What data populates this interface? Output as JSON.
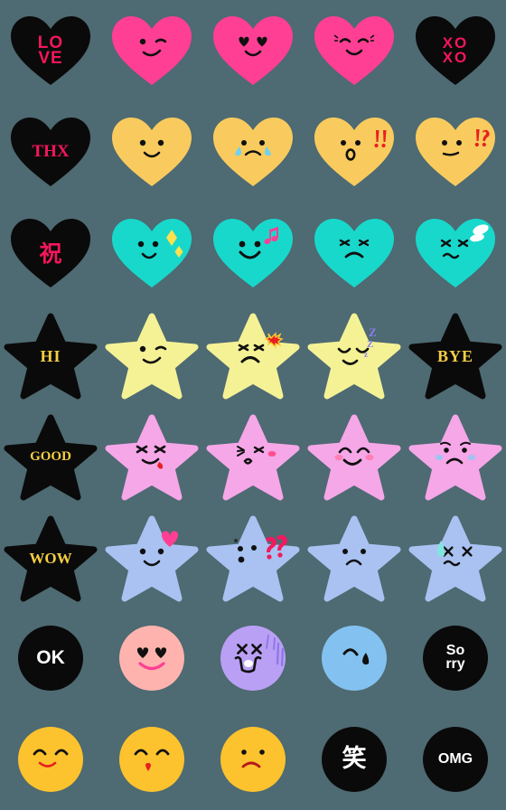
{
  "sheet": {
    "background_color": "#4e6a72",
    "columns": 5,
    "rows": 8,
    "cell_size": 112,
    "palette": {
      "black": "#0a0a0a",
      "hot_pink": "#ff3f93",
      "text_pink": "#f4165c",
      "yellow_heart": "#f9cb5e",
      "teal": "#18d8cc",
      "pale_yellow": "#f5f296",
      "pink_star": "#f5a7e8",
      "blue_star": "#a9c2f2",
      "gold_text": "#f6ce43",
      "white": "#ffffff",
      "peach": "#ffb3ae",
      "purple": "#b9a0f5",
      "sky_blue": "#83c2f0",
      "orange_yellow": "#fcc32e",
      "red": "#e8201f",
      "tear_blue": "#6fd2f0",
      "zzz_purple": "#8a7ef0"
    },
    "stickers": [
      {
        "id": "love-heart",
        "row": 1,
        "col": 1,
        "shape": "heart",
        "fill": "#0a0a0a",
        "text": "LO\nVE",
        "text_style": "lbl-love",
        "face": "none",
        "decor": "none"
      },
      {
        "id": "wink-heart",
        "row": 1,
        "col": 2,
        "shape": "heart",
        "fill": "#ff3f93",
        "text": "",
        "text_style": "",
        "face": "wink",
        "decor": "none"
      },
      {
        "id": "heart-eyes-heart",
        "row": 1,
        "col": 3,
        "shape": "heart",
        "fill": "#ff3f93",
        "text": "",
        "text_style": "",
        "face": "heart-eyes",
        "decor": "none"
      },
      {
        "id": "blush-smile-heart",
        "row": 1,
        "col": 4,
        "shape": "heart",
        "fill": "#ff3f93",
        "text": "",
        "text_style": "",
        "face": "closed-smile",
        "decor": "none"
      },
      {
        "id": "xoxo-heart",
        "row": 1,
        "col": 5,
        "shape": "heart",
        "fill": "#0a0a0a",
        "text": "XO\nXO",
        "text_style": "lbl-xoxo",
        "face": "none",
        "decor": "none"
      },
      {
        "id": "thx-heart",
        "row": 2,
        "col": 1,
        "shape": "heart",
        "fill": "#0a0a0a",
        "text": "THX",
        "text_style": "lbl-thx",
        "face": "none",
        "decor": "none"
      },
      {
        "id": "smile-yellow-heart",
        "row": 2,
        "col": 2,
        "shape": "heart",
        "fill": "#f9cb5e",
        "text": "",
        "text_style": "",
        "face": "smile",
        "decor": "none"
      },
      {
        "id": "crying-yellow-heart",
        "row": 2,
        "col": 3,
        "shape": "heart",
        "fill": "#f9cb5e",
        "text": "",
        "text_style": "",
        "face": "crying",
        "decor": "tears"
      },
      {
        "id": "shocked-yellow-heart",
        "row": 2,
        "col": 4,
        "shape": "heart",
        "fill": "#f9cb5e",
        "text": "",
        "text_style": "",
        "face": "oh-mouth",
        "decor": "double-bang"
      },
      {
        "id": "confused-yellow-heart",
        "row": 2,
        "col": 5,
        "shape": "heart",
        "fill": "#f9cb5e",
        "text": "",
        "text_style": "",
        "face": "flat-mouth",
        "decor": "interrobang"
      },
      {
        "id": "iwai-heart",
        "row": 3,
        "col": 1,
        "shape": "heart",
        "fill": "#0a0a0a",
        "text": "祝",
        "text_style": "lbl-kanji",
        "face": "none",
        "decor": "none"
      },
      {
        "id": "sparkle-teal-heart",
        "row": 3,
        "col": 2,
        "shape": "heart",
        "fill": "#18d8cc",
        "text": "",
        "text_style": "",
        "face": "smile-left",
        "decor": "sparkles"
      },
      {
        "id": "music-teal-heart",
        "row": 3,
        "col": 3,
        "shape": "heart",
        "fill": "#18d8cc",
        "text": "",
        "text_style": "",
        "face": "big-smile",
        "decor": "music-notes"
      },
      {
        "id": "angry-teal-heart",
        "row": 3,
        "col": 4,
        "shape": "heart",
        "fill": "#18d8cc",
        "text": "",
        "text_style": "",
        "face": "angry",
        "decor": "none"
      },
      {
        "id": "annoyed-teal-heart",
        "row": 3,
        "col": 5,
        "shape": "heart",
        "fill": "#18d8cc",
        "text": "",
        "text_style": "",
        "face": "squint-wavy",
        "decor": "anger-puff"
      },
      {
        "id": "hi-star",
        "row": 4,
        "col": 1,
        "shape": "star",
        "fill": "#0a0a0a",
        "text": "HI",
        "text_style": "lbl-gold",
        "face": "none",
        "decor": "none"
      },
      {
        "id": "wink-yellow-star",
        "row": 4,
        "col": 2,
        "shape": "star",
        "fill": "#f5f296",
        "text": "",
        "text_style": "",
        "face": "wink",
        "decor": "none"
      },
      {
        "id": "angry-yellow-star",
        "row": 4,
        "col": 3,
        "shape": "star",
        "fill": "#f5f296",
        "text": "",
        "text_style": "",
        "face": "angry-frown",
        "decor": "anger-mark"
      },
      {
        "id": "sleepy-yellow-star",
        "row": 4,
        "col": 4,
        "shape": "star",
        "fill": "#f5f296",
        "text": "",
        "text_style": "",
        "face": "sleeping",
        "decor": "zzz"
      },
      {
        "id": "bye-star",
        "row": 4,
        "col": 5,
        "shape": "star",
        "fill": "#0a0a0a",
        "text": "BYE",
        "text_style": "lbl-gold",
        "face": "none",
        "decor": "none"
      },
      {
        "id": "good-star",
        "row": 5,
        "col": 1,
        "shape": "star",
        "fill": "#0a0a0a",
        "text": "GOOD",
        "text_style": "lbl-good",
        "face": "none",
        "decor": "none"
      },
      {
        "id": "tongue-pink-star",
        "row": 5,
        "col": 2,
        "shape": "star",
        "fill": "#f5a7e8",
        "text": "",
        "text_style": "",
        "face": "tongue-out",
        "decor": "none"
      },
      {
        "id": "kiss-pink-star",
        "row": 5,
        "col": 3,
        "shape": "star",
        "fill": "#f5a7e8",
        "text": "",
        "text_style": "",
        "face": "kiss-wink",
        "decor": "blush-right"
      },
      {
        "id": "happy-pink-star",
        "row": 5,
        "col": 4,
        "shape": "star",
        "fill": "#f5a7e8",
        "text": "",
        "text_style": "",
        "face": "arch-smile",
        "decor": "blush-both"
      },
      {
        "id": "sad-pink-star",
        "row": 5,
        "col": 5,
        "shape": "star",
        "fill": "#f5a7e8",
        "text": "",
        "text_style": "",
        "face": "worried",
        "decor": "blue-blush"
      },
      {
        "id": "wow-star",
        "row": 6,
        "col": 1,
        "shape": "star",
        "fill": "#0a0a0a",
        "text": "WOW",
        "text_style": "lbl-wow",
        "face": "none",
        "decor": "none"
      },
      {
        "id": "love-blue-star",
        "row": 6,
        "col": 2,
        "shape": "star",
        "fill": "#a9c2f2",
        "text": "",
        "text_style": "",
        "face": "smile",
        "decor": "mini-heart"
      },
      {
        "id": "puzzled-blue-star",
        "row": 6,
        "col": 3,
        "shape": "star",
        "fill": "#a9c2f2",
        "text": "",
        "text_style": "",
        "face": "dots-face",
        "decor": "double-question"
      },
      {
        "id": "sad-blue-star",
        "row": 6,
        "col": 4,
        "shape": "star",
        "fill": "#a9c2f2",
        "text": "",
        "text_style": "",
        "face": "frown",
        "decor": "none"
      },
      {
        "id": "dead-blue-star",
        "row": 6,
        "col": 5,
        "shape": "star",
        "fill": "#a9c2f2",
        "text": "",
        "text_style": "",
        "face": "x-eyes-wavy",
        "decor": "sweat-drop"
      },
      {
        "id": "ok-circle",
        "row": 7,
        "col": 1,
        "shape": "circle",
        "fill": "#0a0a0a",
        "text": "OK",
        "text_style": "lbl-white",
        "face": "none",
        "decor": "none"
      },
      {
        "id": "heart-eyes-circle",
        "row": 7,
        "col": 2,
        "shape": "circle",
        "fill": "#ffb3ae",
        "text": "",
        "text_style": "",
        "face": "heart-eyes-pink",
        "decor": "none"
      },
      {
        "id": "wailing-purple-circle",
        "row": 7,
        "col": 3,
        "shape": "circle",
        "fill": "#b9a0f5",
        "text": "",
        "text_style": "",
        "face": "x-eyes-wail",
        "decor": "shock-lines"
      },
      {
        "id": "crying-blue-circle",
        "row": 7,
        "col": 4,
        "shape": "circle",
        "fill": "#83c2f0",
        "text": "",
        "text_style": "",
        "face": "single-tear",
        "decor": "none"
      },
      {
        "id": "sorry-circle",
        "row": 7,
        "col": 5,
        "shape": "circle",
        "fill": "#0a0a0a",
        "text": "So\nrry",
        "text_style": "lbl-sorry",
        "face": "none",
        "decor": "none"
      },
      {
        "id": "smile-circle",
        "row": 8,
        "col": 1,
        "shape": "circle",
        "fill": "#fcc32e",
        "text": "",
        "text_style": "",
        "face": "arch-eyes-smile",
        "decor": "none"
      },
      {
        "id": "kiss-circle",
        "row": 8,
        "col": 2,
        "shape": "circle",
        "fill": "#fcc32e",
        "text": "",
        "text_style": "",
        "face": "kiss-lips",
        "decor": "none"
      },
      {
        "id": "frown-circle",
        "row": 8,
        "col": 3,
        "shape": "circle",
        "fill": "#fcc32e",
        "text": "",
        "text_style": "",
        "face": "dot-frown",
        "decor": "none"
      },
      {
        "id": "warai-circle",
        "row": 8,
        "col": 4,
        "shape": "circle",
        "fill": "#0a0a0a",
        "text": "笑",
        "text_style": "lbl-warai",
        "face": "none",
        "decor": "none"
      },
      {
        "id": "omg-circle",
        "row": 8,
        "col": 5,
        "shape": "circle",
        "fill": "#0a0a0a",
        "text": "OMG",
        "text_style": "lbl-omg",
        "face": "none",
        "decor": "none"
      }
    ]
  }
}
